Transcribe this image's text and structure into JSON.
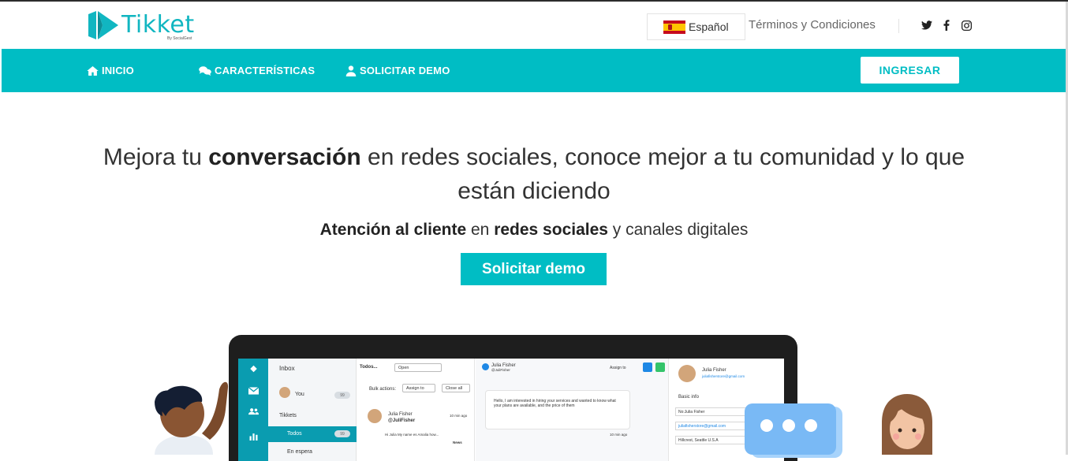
{
  "header": {
    "logo_text": "Tikket",
    "logo_sub": "By SocialGest",
    "language": {
      "label": "Español",
      "flag_icon": "spain-flag-icon"
    },
    "terms_link": "Términos y Condiciones",
    "social": [
      "twitter-icon",
      "facebook-icon",
      "instagram-icon"
    ]
  },
  "nav": {
    "items": [
      {
        "label": "INICIO",
        "icon": "home-icon"
      },
      {
        "label": "CARACTERÍSTICAS",
        "icon": "chat-bubbles-icon"
      },
      {
        "label": "SOLICITAR DEMO",
        "icon": "user-demo-icon"
      }
    ],
    "login_label": "INGRESAR"
  },
  "hero": {
    "headline_pre": "Mejora tu ",
    "headline_bold": "conversación",
    "headline_post": " en redes sociales, conoce mejor a tu comunidad y lo que están diciendo",
    "sub_bold1": "Atención al cliente",
    "sub_mid": " en ",
    "sub_bold2": "redes sociales",
    "sub_post": " y canales digitales",
    "cta_label": "Solicitar demo"
  },
  "mockup": {
    "inbox_title": "Inbox",
    "user_label": "You",
    "user_badge": "99",
    "tickets_label": "Tikkets",
    "todos_label": "Todos",
    "todos_badge": "99",
    "en_espera_label": "En espera",
    "filter_label": "Todos...",
    "status_select": "Open",
    "bulk_label": "Bulk actions:",
    "assign_select": "Assign to",
    "close_all": "Close all",
    "ticket_name": "Julia Fisher",
    "ticket_handle": "@JuliFisher",
    "ticket_time": "10 min ago",
    "ticket_preview": "Hi Julia My name es Amalia how...",
    "ticket_tag": "News",
    "chat_name": "Julia Fisher",
    "chat_handle": "@JuliFisher",
    "chat_assign": "Assign to",
    "chat_message": "Hello, I am interested in hiring your services and wanted to know what your plans are available, and the price of them",
    "chat_time": "10 min ago",
    "profile_name": "Julia Fisher",
    "profile_email": "juliafisherstore@gmail.com",
    "basic_info": "Basic info",
    "field_name": "No:Julia Fisher",
    "field_email": "juliafisherstore@gmail.com",
    "field_location": "Hillcrest, Seattle U.S.A"
  },
  "colors": {
    "brand": "#00bdc4",
    "logo": "#11b6c1",
    "rail": "#0a9cb0",
    "bubble": "#79b9f5"
  }
}
